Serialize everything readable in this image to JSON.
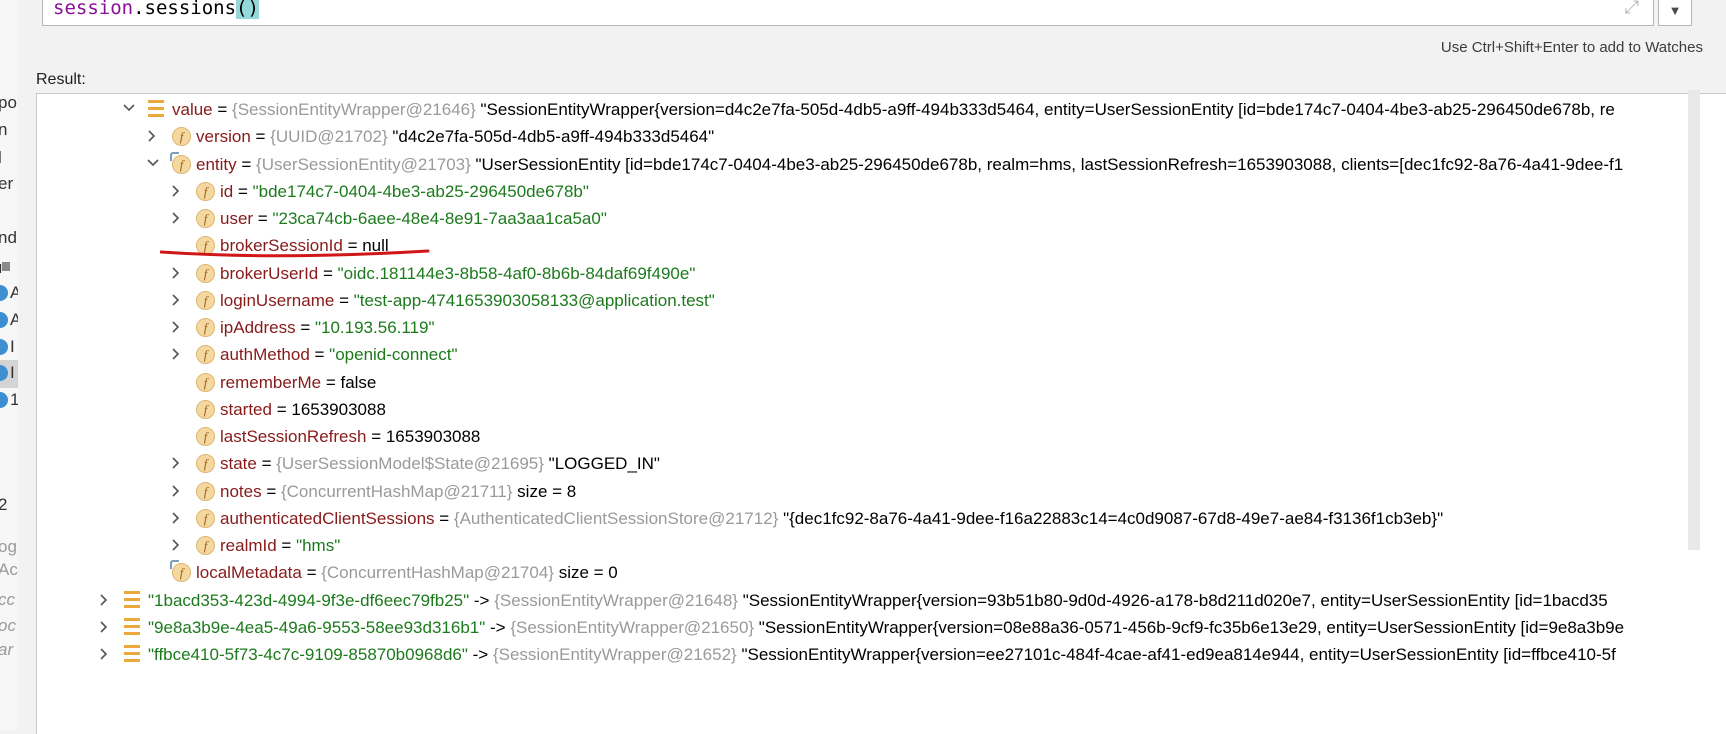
{
  "expression": {
    "object": "session",
    "dot": ".",
    "method": "sessions",
    "parens": "()"
  },
  "hint_text": "Use Ctrl+Shift+Enter to add to Watches",
  "result_label": "Result:",
  "left_strip_fragments": [
    "po",
    "n",
    "l",
    "er",
    "nd",
    "ı",
    "A",
    "A",
    "I",
    "I",
    "1",
    "2",
    "og",
    "Ac",
    "cc",
    "oc",
    "ar"
  ],
  "tree": [
    {
      "expanded": true,
      "icon": "list",
      "name": "value",
      "op": " = ",
      "type": "{SessionEntityWrapper@21646}",
      "value": " \"SessionEntityWrapper{version=d4c2e7fa-505d-4db5-a9ff-494b333d5464, entity=UserSessionEntity [id=bde174c7-0404-4be3-ab25-296450de678b, re"
    },
    {
      "expanded": false,
      "icon": "field",
      "name": "version",
      "op": " = ",
      "type": "{UUID@21702}",
      "value": " \"d4c2e7fa-505d-4db5-a9ff-494b333d5464\""
    },
    {
      "expanded": true,
      "icon": "field-decl",
      "name": "entity",
      "op": " = ",
      "type": "{UserSessionEntity@21703}",
      "value": " \"UserSessionEntity [id=bde174c7-0404-4be3-ab25-296450de678b, realm=hms, lastSessionRefresh=1653903088, clients=[dec1fc92-8a76-4a41-9dee-f1"
    },
    {
      "expanded": false,
      "icon": "field",
      "name": "id",
      "op": " = ",
      "str": "\"bde174c7-0404-4be3-ab25-296450de678b\""
    },
    {
      "expanded": false,
      "icon": "field",
      "name": "user",
      "op": " = ",
      "str": "\"23ca74cb-6aee-48e4-8e91-7aa3aa1ca5a0\""
    },
    {
      "leaf": true,
      "icon": "field",
      "name": "brokerSessionId",
      "op": " = ",
      "plain": "null"
    },
    {
      "expanded": false,
      "icon": "field",
      "name": "brokerUserId",
      "op": " = ",
      "str": "\"oidc.181144e3-8b58-4af0-8b6b-84daf69f490e\""
    },
    {
      "expanded": false,
      "icon": "field",
      "name": "loginUsername",
      "op": " = ",
      "str": "\"test-app-4741653903058133@application.test\""
    },
    {
      "expanded": false,
      "icon": "field",
      "name": "ipAddress",
      "op": " = ",
      "str": "\"10.193.56.119\""
    },
    {
      "expanded": false,
      "icon": "field",
      "name": "authMethod",
      "op": " = ",
      "str": "\"openid-connect\""
    },
    {
      "leaf": true,
      "icon": "field",
      "name": "rememberMe",
      "op": " = ",
      "plain": "false"
    },
    {
      "leaf": true,
      "icon": "field",
      "name": "started",
      "op": " = ",
      "plain": "1653903088"
    },
    {
      "leaf": true,
      "icon": "field",
      "name": "lastSessionRefresh",
      "op": " = ",
      "plain": "1653903088"
    },
    {
      "expanded": false,
      "icon": "field",
      "name": "state",
      "op": " = ",
      "type": "{UserSessionModel$State@21695}",
      "value": " \"LOGGED_IN\""
    },
    {
      "expanded": false,
      "icon": "field",
      "name": "notes",
      "op": " = ",
      "type": "{ConcurrentHashMap@21711}",
      "value": "  size = 8"
    },
    {
      "expanded": false,
      "icon": "field",
      "name": "authenticatedClientSessions",
      "op": " = ",
      "type": "{AuthenticatedClientSessionStore@21712}",
      "value": " \"{dec1fc92-8a76-4a41-9dee-f16a22883c14=4c0d9087-67d8-49e7-ae84-f3136f1cb3eb}\""
    },
    {
      "expanded": false,
      "icon": "field",
      "name": "realmId",
      "op": " = ",
      "str": "\"hms\""
    },
    {
      "leaf": true,
      "icon": "field-decl",
      "name": "localMetadata",
      "op": " = ",
      "type": "{ConcurrentHashMap@21704}",
      "value": "  size = 0"
    },
    {
      "expanded": false,
      "icon": "list",
      "key": "\"1bacd353-423d-4994-9f3e-df6eec79fb25\"",
      "op": " -> ",
      "type": "{SessionEntityWrapper@21648}",
      "value": " \"SessionEntityWrapper{version=93b51b80-9d0d-4926-a178-b8d211d020e7, entity=UserSessionEntity [id=1bacd35"
    },
    {
      "expanded": false,
      "icon": "list",
      "key": "\"9e8a3b9e-4ea5-49a6-9553-58ee93d316b1\"",
      "op": " -> ",
      "type": "{SessionEntityWrapper@21650}",
      "value": " \"SessionEntityWrapper{version=08e88a36-0571-456b-9cf9-fc35b6e13e29, entity=UserSessionEntity [id=9e8a3b9e"
    },
    {
      "expanded": false,
      "icon": "list",
      "key": "\"ffbce410-5f73-4c7c-9109-85870b0968d6\"",
      "op": " -> ",
      "type": "{SessionEntityWrapper@21652}",
      "value": " \"SessionEntityWrapper{version=ee27101c-484f-4cae-af41-ed9ea814e944, entity=UserSessionEntity [id=ffbce410-5f"
    }
  ],
  "colors": {
    "field_name": "#871a1a",
    "type_ref": "#9a9a9a",
    "string_value": "#1c7a1c",
    "annotation_underline": "#d01616",
    "expr_object": "#871094",
    "paren_highlight": "#93d9d9"
  }
}
